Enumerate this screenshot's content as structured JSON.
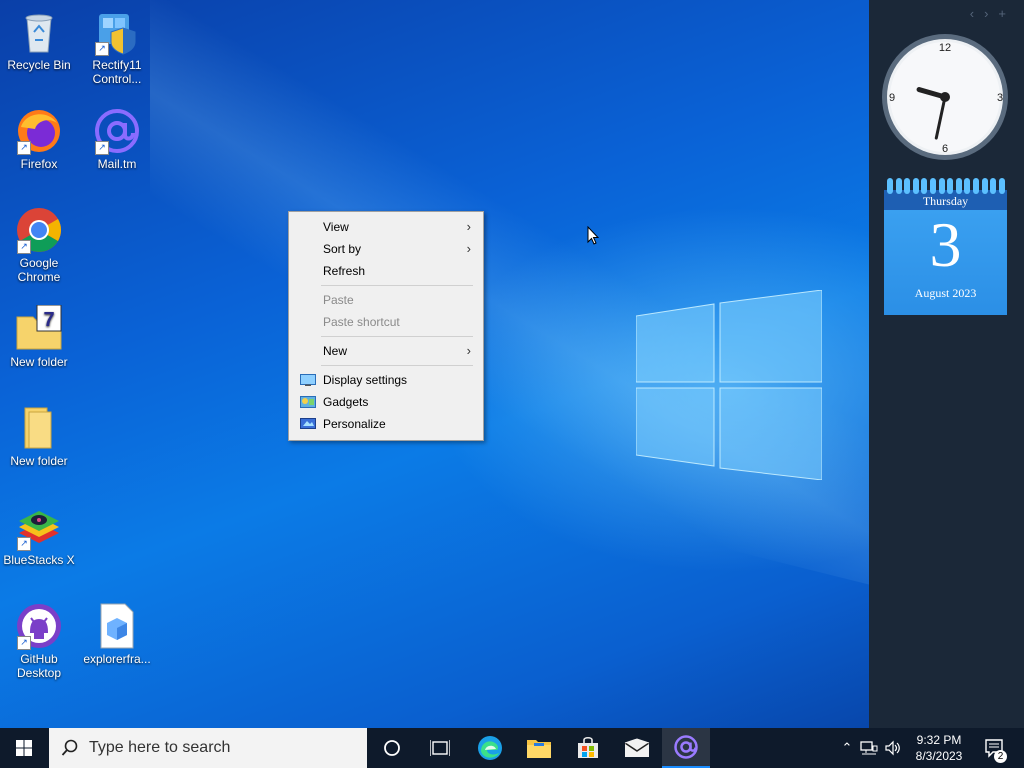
{
  "desktop_icons": [
    {
      "label": "Recycle Bin",
      "icon": "recycle-bin-icon"
    },
    {
      "label": "Rectify11 Control...",
      "icon": "control-panel-icon"
    },
    {
      "label": "Firefox",
      "icon": "firefox-icon"
    },
    {
      "label": "Mail.tm",
      "icon": "mail-at-icon"
    },
    {
      "label": "Google Chrome",
      "icon": "chrome-icon"
    },
    {
      "label": "New folder",
      "icon": "folder-icon"
    },
    {
      "label": "New folder",
      "icon": "folder-icon"
    },
    {
      "label": "BlueStacks X",
      "icon": "bluestacks-icon"
    },
    {
      "label": "GitHub Desktop",
      "icon": "github-icon"
    },
    {
      "label": "explorerfra...",
      "icon": "file-icon"
    }
  ],
  "context_menu": {
    "items": [
      {
        "label": "View",
        "submenu": true
      },
      {
        "label": "Sort by",
        "submenu": true
      },
      {
        "label": "Refresh"
      },
      {
        "label": "Paste",
        "disabled": true
      },
      {
        "label": "Paste shortcut",
        "disabled": true
      },
      {
        "label": "New",
        "submenu": true
      },
      {
        "label": "Display settings",
        "icon": "display-icon"
      },
      {
        "label": "Gadgets",
        "icon": "gadgets-icon"
      },
      {
        "label": "Personalize",
        "icon": "personalize-icon"
      }
    ]
  },
  "sidebar": {
    "nav": [
      "‹",
      "›",
      "+"
    ],
    "clock": {
      "numerals": [
        "12",
        "3",
        "6",
        "9"
      ],
      "time": "9:32"
    },
    "calendar": {
      "weekday": "Thursday",
      "day": "3",
      "month_year": "August 2023"
    }
  },
  "taskbar": {
    "search_placeholder": "Type here to search",
    "apps": [
      "cortana-icon",
      "task-view-icon",
      "edge-icon",
      "file-explorer-icon",
      "store-icon",
      "mail-icon",
      "mail-tm-icon"
    ],
    "time": "9:32 PM",
    "date": "8/3/2023",
    "notification_count": "2",
    "accent": "#1a8cff"
  }
}
